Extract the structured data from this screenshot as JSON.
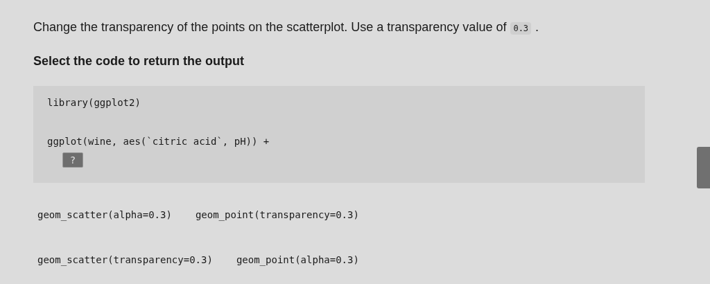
{
  "question": [
    {
      "kind": "text",
      "text": "Change the transparency of the points on the scatterplot. Use a transparency value of"
    },
    {
      "kind": "code",
      "text": "0.3"
    },
    {
      "kind": "text",
      "text": "."
    }
  ],
  "instruction": "Select the code to return the output",
  "code_block": {
    "lines": [
      "library(ggplot2)",
      "ggplot(wine, aes(`citric acid`, pH)) +"
    ],
    "blank": "?"
  },
  "options": [
    [
      {
        "text": "geom_scatter(alpha=0.3)",
        "selected": false
      },
      {
        "text": "geom_point(transparency=0.3)",
        "selected": false
      }
    ],
    [
      {
        "text": "geom_scatter(transparency=0.3)",
        "selected": false
      },
      {
        "text": "geom_point(alpha=0.3)",
        "selected": false
      }
    ]
  ]
}
